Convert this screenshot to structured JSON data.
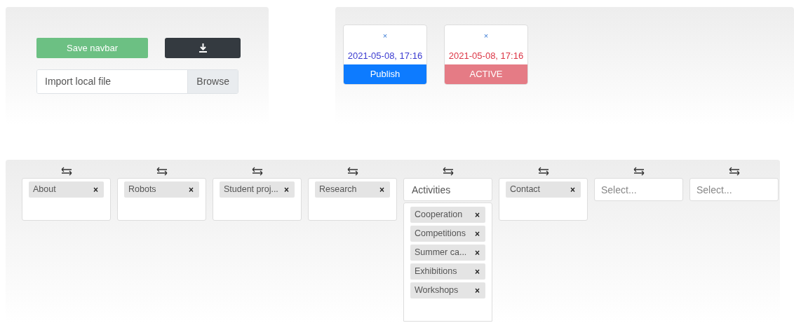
{
  "toolbar": {
    "save_button": "Save navbar",
    "file_input": {
      "placeholder": "Import local file",
      "browse": "Browse"
    }
  },
  "versions": [
    {
      "close": "×",
      "timestamp": "2021-05-08, 17:16",
      "status": "Publish",
      "kind": "publish"
    },
    {
      "close": "×",
      "timestamp": "2021-05-08, 17:16",
      "status": "ACTIVE",
      "kind": "active"
    }
  ],
  "columns": [
    {
      "kind": "tags",
      "tags": [
        {
          "label": "About",
          "remove": "×"
        }
      ]
    },
    {
      "kind": "tags",
      "tags": [
        {
          "label": "Robots",
          "remove": "×"
        }
      ]
    },
    {
      "kind": "tags",
      "tags": [
        {
          "label": "Student proj...",
          "remove": "×"
        }
      ]
    },
    {
      "kind": "tags",
      "tags": [
        {
          "label": "Research",
          "remove": "×"
        }
      ]
    },
    {
      "kind": "group",
      "title": "Activities",
      "tags": [
        {
          "label": "Cooperation",
          "remove": "×"
        },
        {
          "label": "Competitions",
          "remove": "×"
        },
        {
          "label": "Summer ca...",
          "remove": "×"
        },
        {
          "label": "Exhibitions",
          "remove": "×"
        },
        {
          "label": "Workshops",
          "remove": "×"
        }
      ]
    },
    {
      "kind": "tags",
      "tags": [
        {
          "label": "Contact",
          "remove": "×"
        }
      ]
    },
    {
      "kind": "select",
      "placeholder": "Select..."
    },
    {
      "kind": "select",
      "placeholder": "Select..."
    }
  ]
}
